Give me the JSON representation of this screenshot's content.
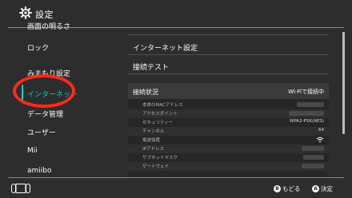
{
  "header": {
    "title": "設定",
    "icon": "gear-icon"
  },
  "sidebar": {
    "items": [
      {
        "label": "画面の明るさ"
      },
      {
        "label": "ロック"
      },
      {
        "label": "みまもり設定"
      },
      {
        "label": "インターネット"
      },
      {
        "label": "データ管理"
      },
      {
        "label": "ユーザー"
      },
      {
        "label": "Mii"
      },
      {
        "label": "amiibo"
      }
    ],
    "active_index": 3
  },
  "main": {
    "items": [
      {
        "label": "インターネット設定"
      },
      {
        "label": "接続テスト"
      }
    ],
    "status_panel": {
      "title": "接続状況",
      "value": "Wi-Fiで接続中",
      "rows": [
        {
          "label": "本体のMACアドレス",
          "value": ""
        },
        {
          "label": "アクセスポイント",
          "value": ""
        },
        {
          "label": "セキュリティー",
          "value": "WPA2-PSK(AES)"
        },
        {
          "label": "チャンネル",
          "value": "64"
        },
        {
          "label": "電波強度",
          "value": ""
        },
        {
          "label": "IPアドレス",
          "value": ""
        },
        {
          "label": "サブネットマスク",
          "value": ""
        },
        {
          "label": "ゲートウェイ",
          "value": ""
        }
      ]
    }
  },
  "footer": {
    "back": {
      "glyph": "B",
      "label": "もどる"
    },
    "ok": {
      "glyph": "A",
      "label": "決定"
    }
  },
  "colors": {
    "accent": "#00d4c8",
    "annotation": "#ff2a18",
    "background": "#2d2d2d"
  }
}
